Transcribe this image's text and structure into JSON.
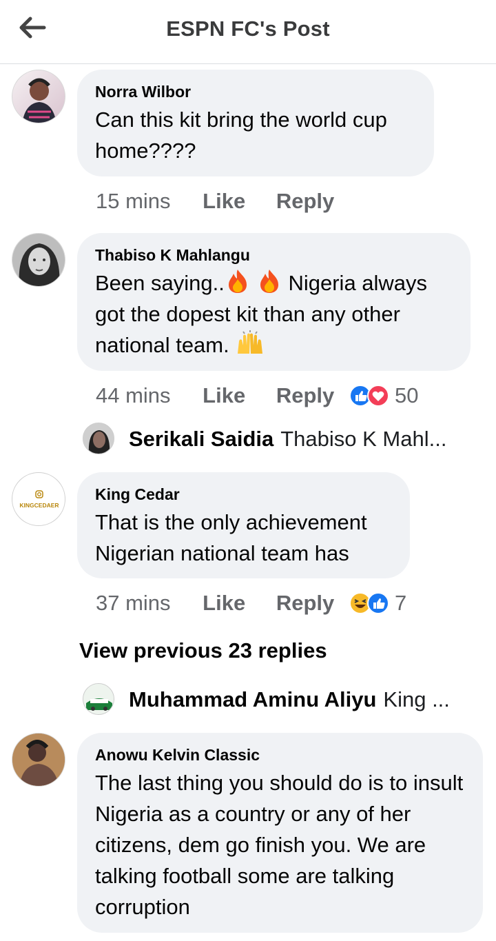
{
  "header": {
    "title": "ESPN FC's Post",
    "back_icon": "arrow-left-icon"
  },
  "comments": [
    {
      "author": "Norra Wilbor",
      "text": "Can this kit bring the world cup home????",
      "time": "15 mins",
      "like": "Like",
      "reply": "Reply"
    },
    {
      "author": "Thabiso K Mahlangu",
      "text_parts": [
        "Been saying..",
        "  Nigeria always got the dopest kit than any other national team. "
      ],
      "emojis": [
        "fire-emoji",
        "fire-emoji",
        "raising-hands-emoji"
      ],
      "time": "44 mins",
      "like": "Like",
      "reply": "Reply",
      "reaction_icons": [
        "like-reaction-icon",
        "love-reaction-icon"
      ],
      "reaction_count": "50",
      "reply_preview": {
        "name": "Serikali Saidia",
        "text": "Thabiso K Mahl..."
      }
    },
    {
      "author": "King Cedar",
      "avatar_text": "KINGCEDAER",
      "text": "That is the only achievement Nigerian national team has",
      "time": "37 mins",
      "like": "Like",
      "reply": "Reply",
      "reaction_icons": [
        "haha-reaction-icon",
        "like-reaction-icon"
      ],
      "reaction_count": "7",
      "view_previous": "View previous 23 replies",
      "reply_preview": {
        "name": "Muhammad Aminu Aliyu",
        "text": "King ..."
      }
    },
    {
      "author": "Anowu Kelvin Classic",
      "text": "The last thing you should do is to insult Nigeria as a country or any of her citizens, dem go finish you. We are talking football some are talking corruption"
    }
  ],
  "colors": {
    "bubble": "#f0f2f5",
    "meta": "#65676b",
    "like_blue": "#1877f2",
    "love_red": "#f33e58",
    "haha_yellow": "#f7b928"
  }
}
